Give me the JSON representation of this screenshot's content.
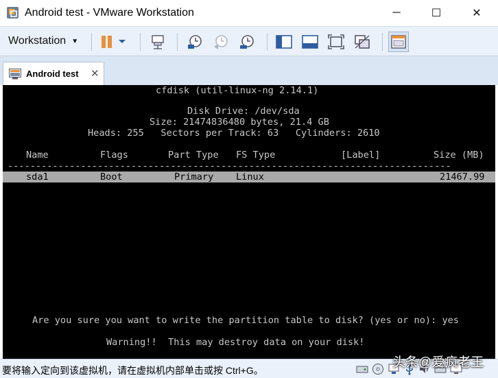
{
  "window": {
    "title": "Android test - VMware Workstation",
    "minimize_glyph": "─",
    "maximize_glyph": "☐",
    "close_glyph": "✕"
  },
  "toolbar": {
    "workstation_menu": "Workstation",
    "icons": [
      "pause-icon",
      "dropdown-arrow-icon",
      "send-ctrl-alt-del-icon",
      "snapshot-take-icon",
      "snapshot-revert-icon",
      "snapshot-manager-icon",
      "library-icon",
      "thumbnail-bar-icon",
      "full-screen-icon",
      "unity-icon",
      "console-view-icon"
    ]
  },
  "tab": {
    "label": "Android test",
    "close_glyph": "✕"
  },
  "console": {
    "line_title": "cfdisk (util-linux-ng 2.14.1)",
    "line_drive": "Disk Drive: /dev/sda",
    "line_size": "Size: 21474836480 bytes, 21.4 GB",
    "line_geometry": "Heads: 255   Sectors per Track: 63   Cylinders: 2610",
    "headers": {
      "name": "Name",
      "flags": "Flags",
      "part_type": "Part Type",
      "fs_type": "FS Type",
      "label": "[Label]",
      "size": "Size (MB)"
    },
    "separator": "-------------------------------------------------------------------------------",
    "partition": {
      "name": "sda1",
      "flags": "Boot",
      "part_type": "Primary",
      "fs_type": "Linux",
      "size": "21467.99"
    },
    "prompt": "Are you sure you want to write the partition table to disk? (yes or no): yes",
    "warning": "Warning!!  This may destroy data on your disk!"
  },
  "statusbar": {
    "text": "要将输入定向到该虚拟机，请在虚拟机内部单击或按 Ctrl+G。",
    "tray_icons": [
      "hard-disk-icon",
      "cd-drive-icon",
      "network-icon",
      "usb-icon",
      "sound-icon",
      "printer-icon",
      "display-icon"
    ]
  },
  "watermark": "头条@爱疯老王",
  "colors": {
    "console_bg": "#000000",
    "console_text": "#c8c8c8",
    "highlight_row": "#a9a9a9",
    "toolbar_bg": "#eaf1fa"
  }
}
